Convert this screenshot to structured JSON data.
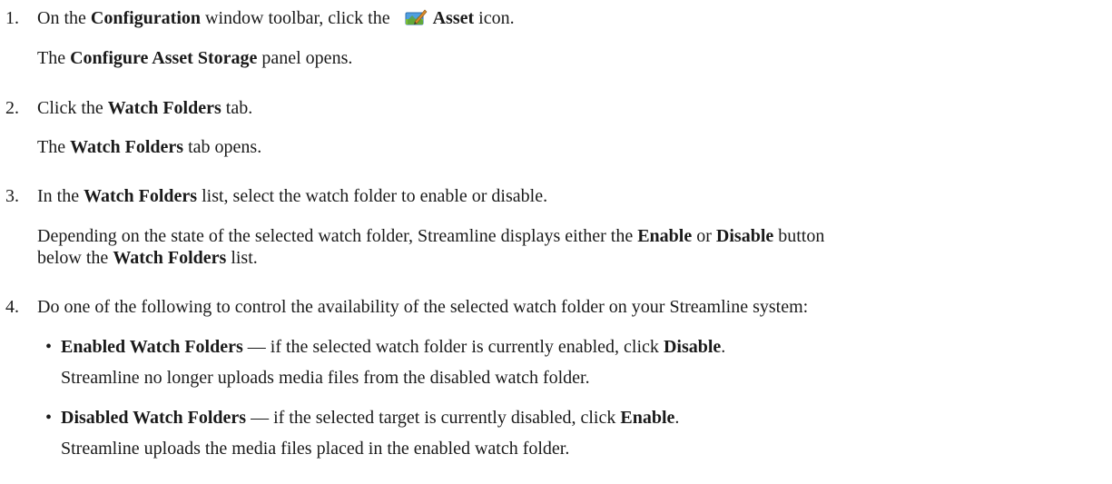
{
  "steps": [
    {
      "number": "1.",
      "instruction": {
        "t1": "On the ",
        "b1": "Configuration",
        "t2": " window toolbar, click the ",
        "icon": "asset-icon",
        "b2": "Asset",
        "t3": " icon."
      },
      "result": {
        "t1": "The ",
        "b1": "Configure Asset Storage",
        "t2": " panel opens."
      }
    },
    {
      "number": "2.",
      "instruction": {
        "t1": "Click the ",
        "b1": "Watch Folders",
        "t2": " tab."
      },
      "result": {
        "t1": "The ",
        "b1": "Watch Folders",
        "t2": " tab opens."
      }
    },
    {
      "number": "3.",
      "instruction": {
        "t1": "In the ",
        "b1": "Watch Folders",
        "t2": " list, select the watch folder to enable or disable."
      },
      "result": {
        "t1": "Depending on the state of the selected watch folder, Streamline displays either the ",
        "b1": "Enable",
        "t2": " or ",
        "b2": "Disable",
        "t3": " button",
        "t4": "below the ",
        "b3": "Watch Folders",
        "t5": " list."
      }
    },
    {
      "number": "4.",
      "instruction": {
        "t1": "Do one of the following to control the availability of the selected watch folder on your Streamline system:"
      },
      "options": [
        {
          "bullet": "•",
          "b1": "Enabled Watch Folders",
          "t1": " — if the selected watch folder is currently enabled, click ",
          "b2": "Disable",
          "t2": ".",
          "note": "Streamline no longer uploads media files from the disabled watch folder."
        },
        {
          "bullet": "•",
          "b1": "Disabled Watch Folders",
          "t1": " — if the selected target is currently disabled, click ",
          "b2": "Enable",
          "t2": ".",
          "note": "Streamline uploads the media files placed in the enabled watch folder."
        }
      ]
    }
  ],
  "colors": {
    "text": "#1a1a1a",
    "icon_blue": "#4f9fe0",
    "icon_green": "#7cbf3a",
    "icon_pen": "#d98a2b"
  }
}
